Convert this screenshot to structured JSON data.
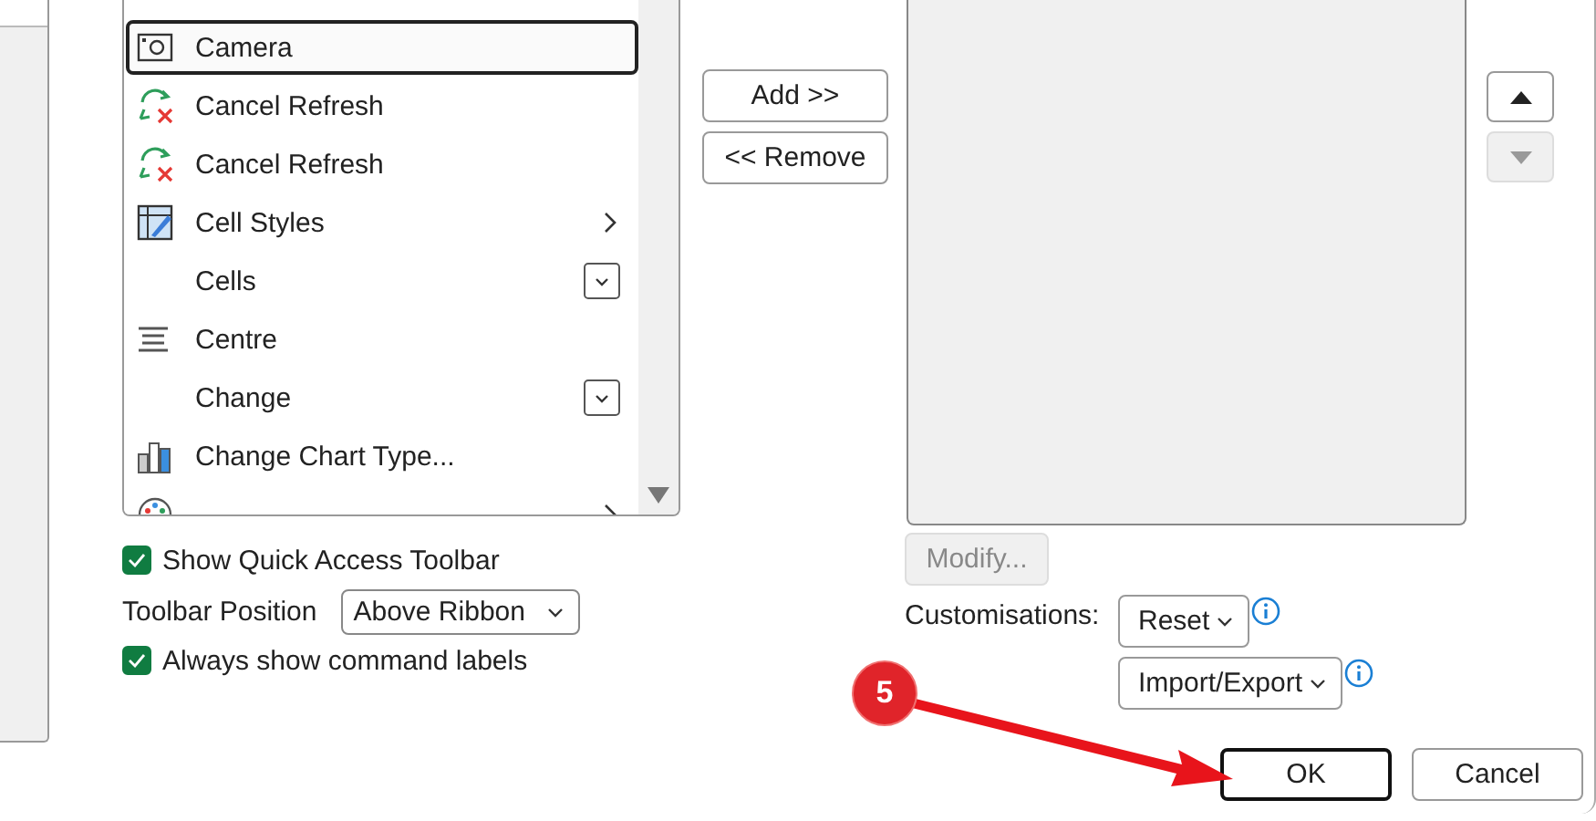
{
  "command_list": {
    "items": [
      {
        "label": "Camera",
        "kind": "camera",
        "selected": true,
        "submenu": false,
        "dropdown": false
      },
      {
        "label": "Cancel Refresh",
        "kind": "cancel-refresh",
        "selected": false,
        "submenu": false,
        "dropdown": false
      },
      {
        "label": "Cancel Refresh",
        "kind": "cancel-refresh",
        "selected": false,
        "submenu": false,
        "dropdown": false
      },
      {
        "label": "Cell Styles",
        "kind": "cell-styles",
        "selected": false,
        "submenu": true,
        "dropdown": false
      },
      {
        "label": "Cells",
        "kind": "plain",
        "selected": false,
        "submenu": false,
        "dropdown": true
      },
      {
        "label": "Centre",
        "kind": "centre",
        "selected": false,
        "submenu": false,
        "dropdown": false
      },
      {
        "label": "Change",
        "kind": "plain",
        "selected": false,
        "submenu": false,
        "dropdown": true
      },
      {
        "label": "Change Chart Type...",
        "kind": "chart",
        "selected": false,
        "submenu": false,
        "dropdown": false
      },
      {
        "kind": "palette",
        "selected": false,
        "submenu": true,
        "dropdown": false
      }
    ]
  },
  "move_buttons": [
    {
      "label": "Add >>",
      "disabled": false
    },
    {
      "label": "<< Remove",
      "disabled": false
    }
  ],
  "order_buttons": [
    {
      "kind": "up",
      "disabled": false
    },
    {
      "kind": "down",
      "disabled": true
    }
  ],
  "modify_button": {
    "label": "Modify...",
    "disabled": true
  },
  "show_toolbar": {
    "label": "Show Quick Access Toolbar",
    "checked": true
  },
  "toolbar_position": {
    "label": "Toolbar Position",
    "value": "Above Ribbon"
  },
  "always_labels": {
    "label": "Always show command labels",
    "checked": true
  },
  "customisations": {
    "label": "Customisations:",
    "buttons": [
      {
        "label": "Reset"
      },
      {
        "label": "Import/Export"
      }
    ]
  },
  "dialog_buttons": [
    {
      "label": "OK",
      "default": true
    },
    {
      "label": "Cancel",
      "default": false
    }
  ],
  "callout": {
    "number": "5"
  }
}
